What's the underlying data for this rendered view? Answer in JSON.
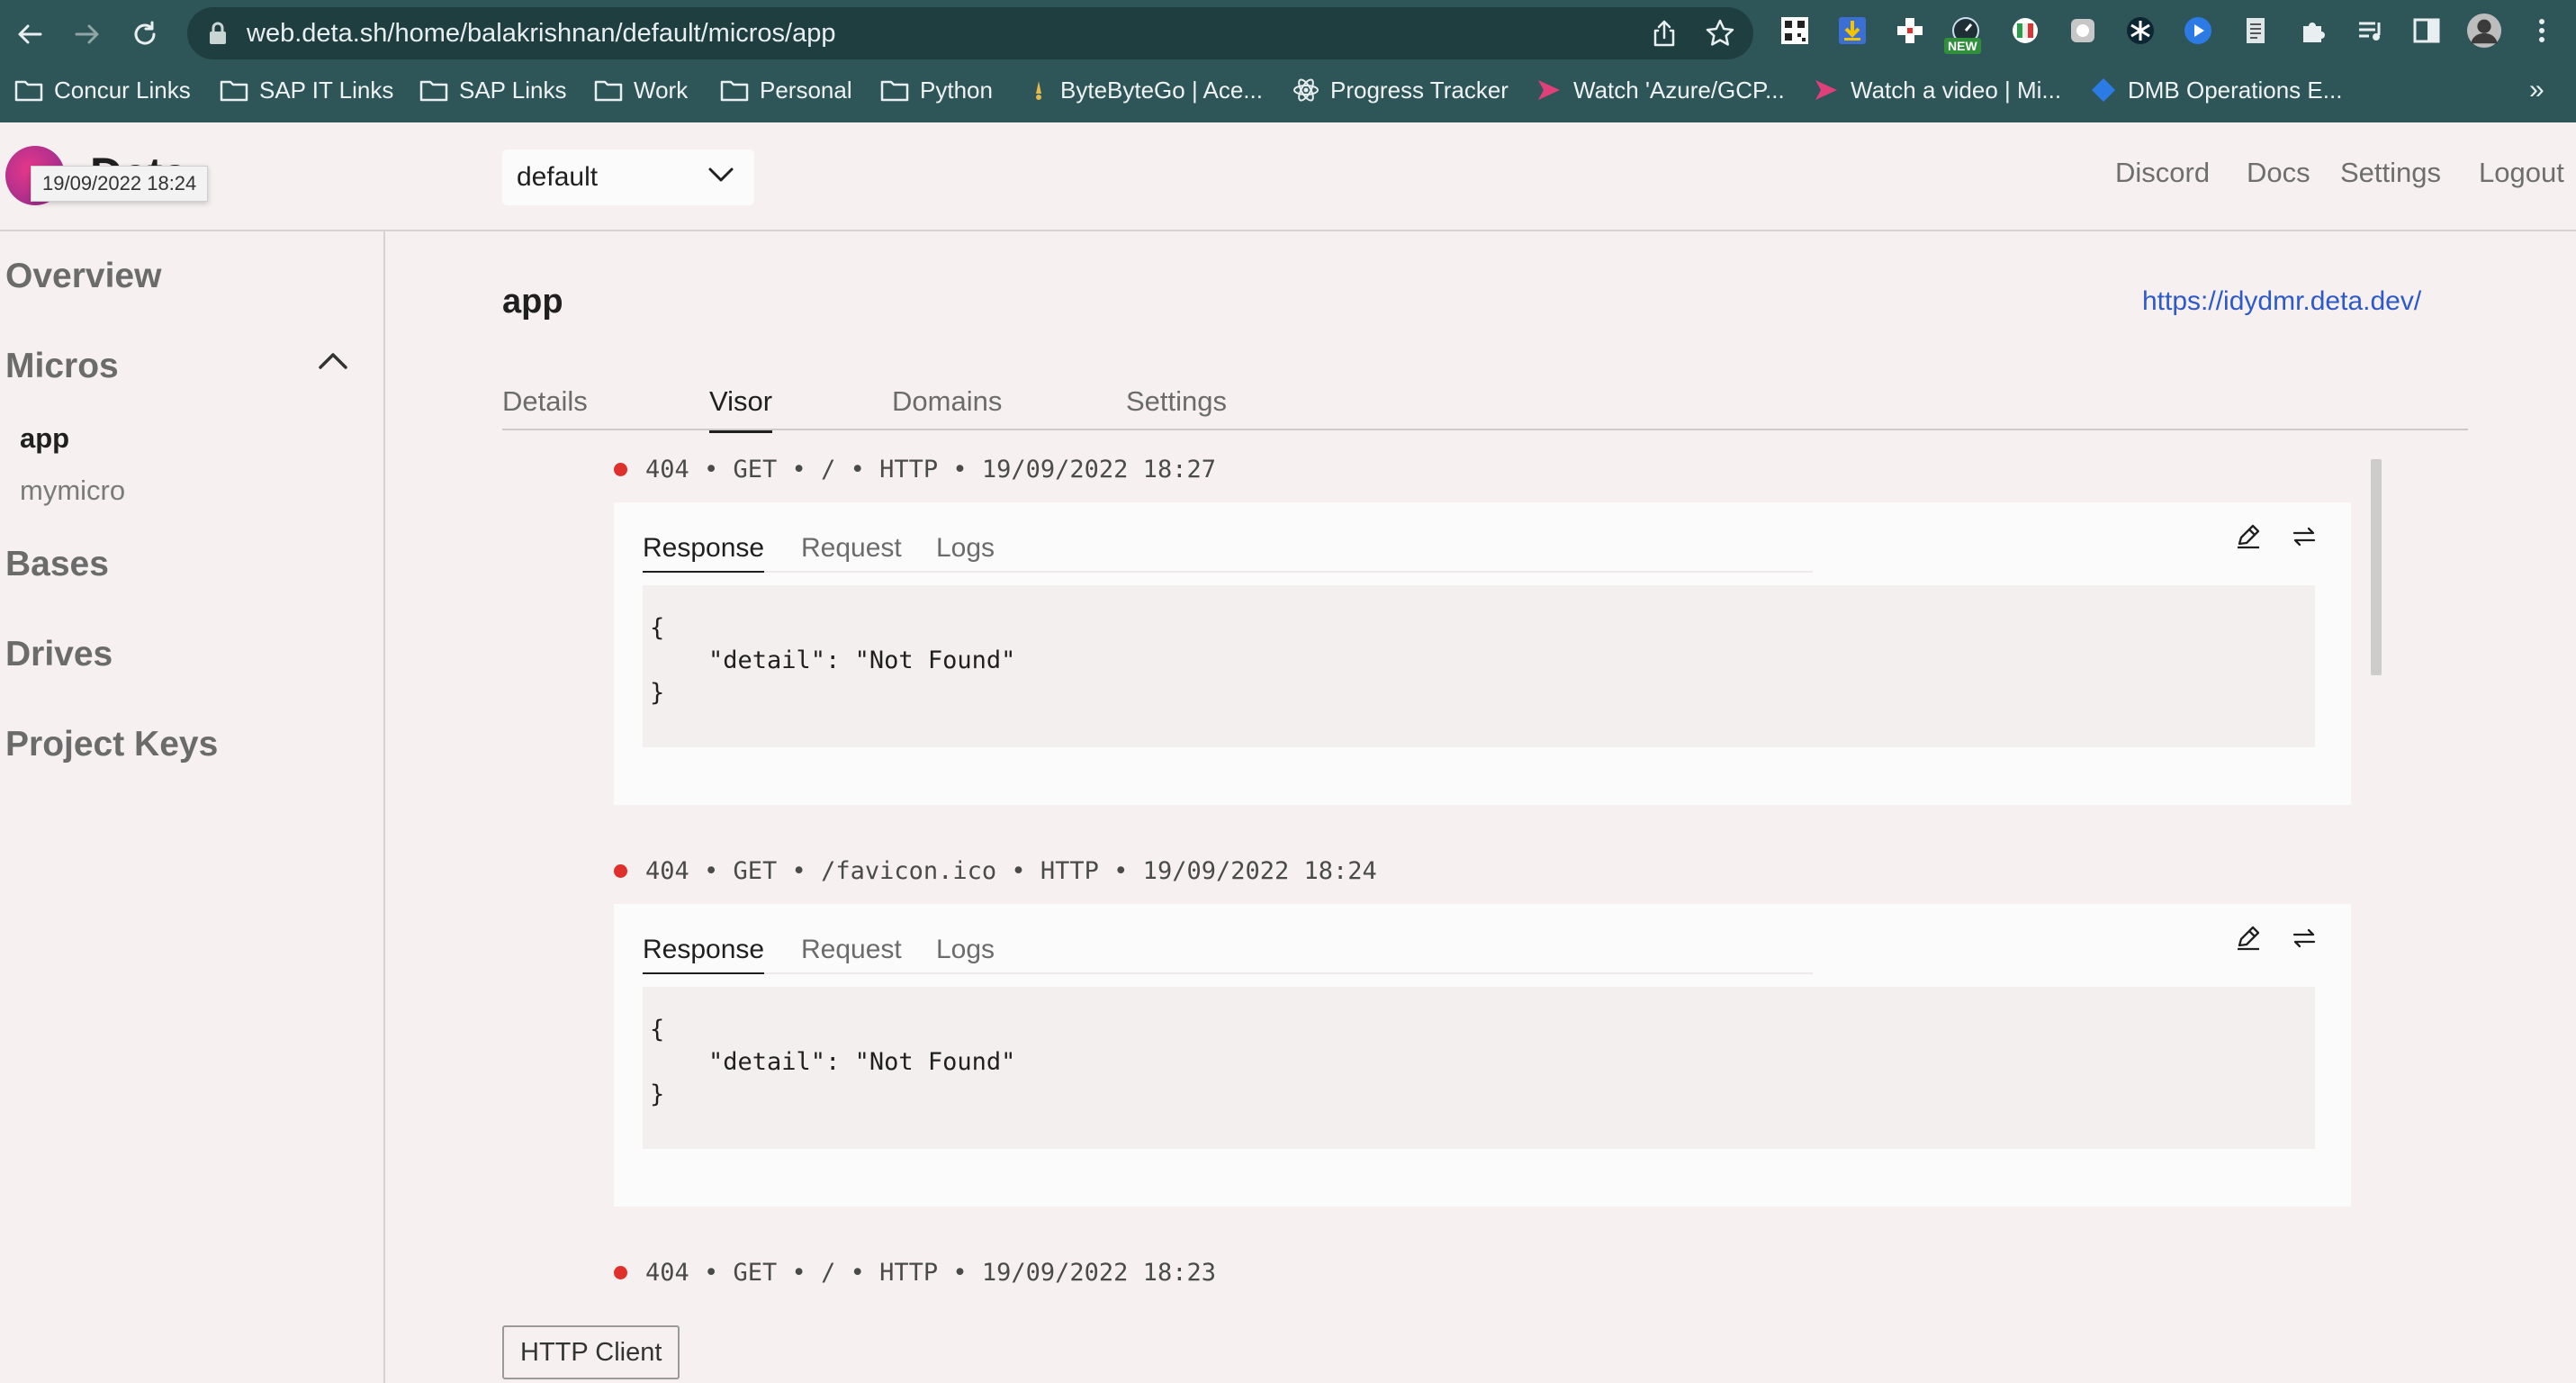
{
  "browser": {
    "url": "web.deta.sh/home/balakrishnan/default/micros/app",
    "new_badge": "NEW",
    "bookmarks": [
      "Concur Links",
      "SAP IT Links",
      "SAP Links",
      "Work",
      "Personal",
      "Python",
      "ByteByteGo | Ace...",
      "Progress Tracker",
      "Watch 'Azure/GCP...",
      "Watch a video | Mi...",
      "DMB Operations E..."
    ],
    "more": "»"
  },
  "header": {
    "logo_text": "Deta",
    "tooltip": "19/09/2022 18:24",
    "project": "default",
    "nav": [
      "Discord",
      "Docs",
      "Settings",
      "Logout"
    ]
  },
  "sidebar": {
    "overview": "Overview",
    "micros": "Micros",
    "micro_items": [
      "app",
      "mymicro"
    ],
    "bases": "Bases",
    "drives": "Drives",
    "project_keys": "Project Keys"
  },
  "main": {
    "title": "app",
    "url": "https://idydmr.deta.dev/",
    "tabs": [
      "Details",
      "Visor",
      "Domains",
      "Settings"
    ],
    "entries": [
      {
        "line": "404 • GET • / • HTTP • 19/09/2022 18:27",
        "tabs": [
          "Response",
          "Request",
          "Logs"
        ],
        "code": [
          "{",
          "    \"detail\": \"Not Found\"",
          "}"
        ]
      },
      {
        "line": "404 • GET • /favicon.ico • HTTP • 19/09/2022 18:24",
        "tabs": [
          "Response",
          "Request",
          "Logs"
        ],
        "code": [
          "{",
          "    \"detail\": \"Not Found\"",
          "}"
        ]
      },
      {
        "line": "404 • GET • / • HTTP • 19/09/2022 18:23"
      }
    ],
    "http_client": "HTTP Client"
  },
  "colors": {
    "browser_chrome": "#2e5557",
    "page_bg": "#f6f1f0",
    "link": "#2d59c9",
    "error_dot": "#e0302b"
  }
}
